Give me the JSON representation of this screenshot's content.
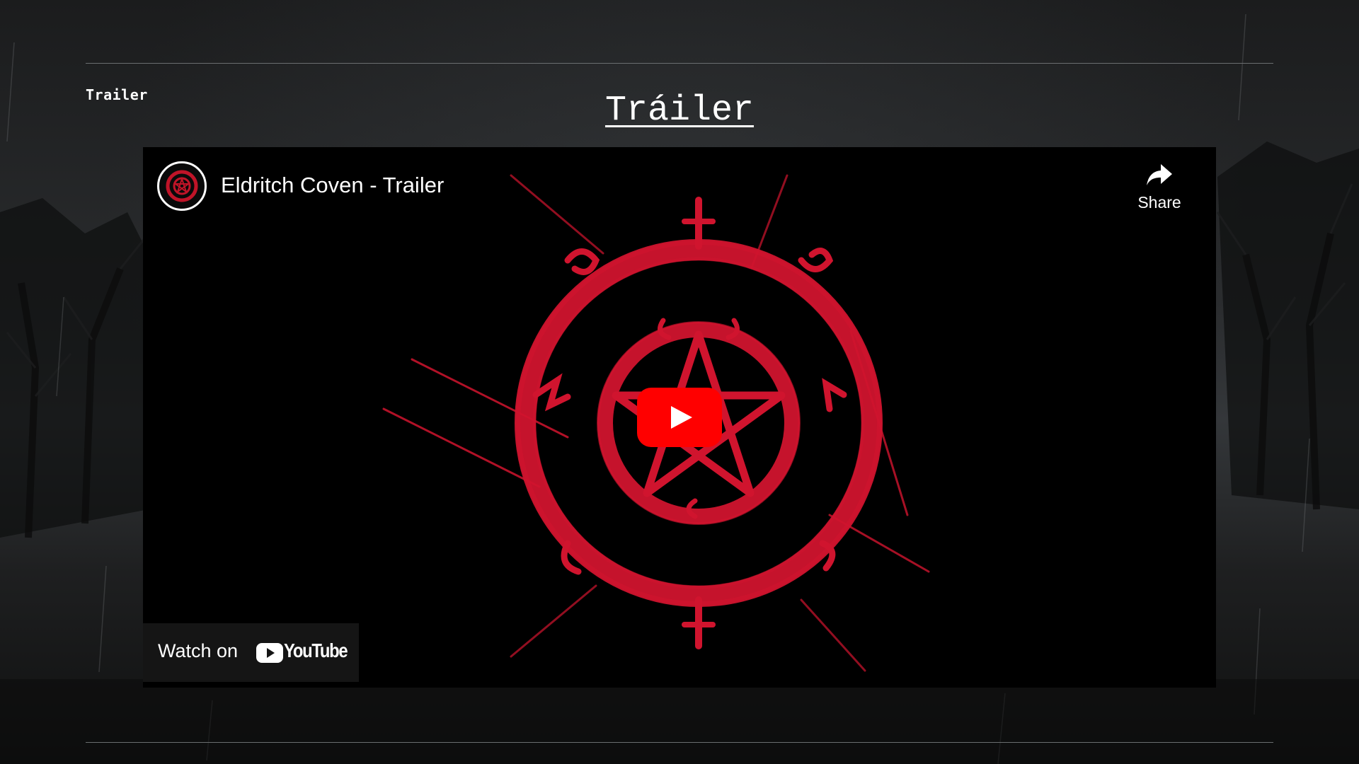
{
  "section": {
    "breadcrumb": "Trailer",
    "heading": "Tráiler"
  },
  "video": {
    "title": "Eldritch Coven - Trailer",
    "share_label": "Share",
    "watch_on_label": "Watch on",
    "platform_name": "YouTube",
    "icons": {
      "channel": "channel-sigil-icon",
      "share": "share-arrow-icon",
      "play": "play-icon",
      "platform": "youtube-logo-icon"
    },
    "colors": {
      "sigil": "#d0142e",
      "play_button": "#ff0000"
    }
  }
}
